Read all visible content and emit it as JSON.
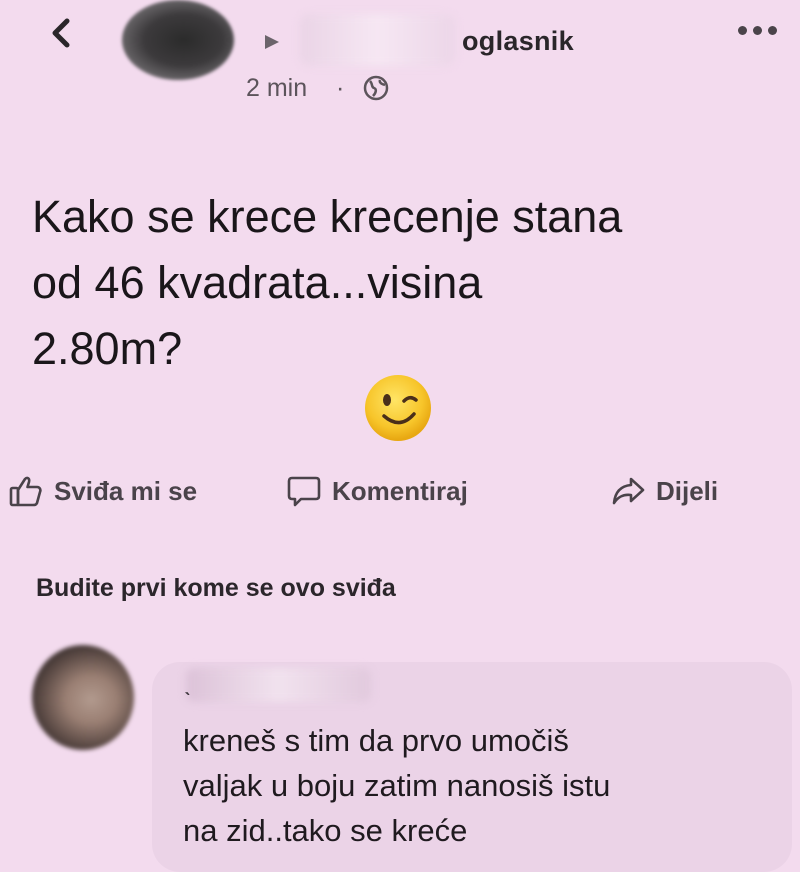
{
  "header": {
    "back_icon": "chevron-left-icon",
    "group_name": "oglasnik",
    "time": "2 min",
    "separator": "·",
    "audience_icon": "globe-icon",
    "more_icon": "ellipsis-icon"
  },
  "post": {
    "text": "Kako se krece krecenje stana\nod 46 kvadrata...visina\n2.80m?",
    "emoji": "winking-face-icon"
  },
  "actions": {
    "like": "Sviđa mi se",
    "comment": "Komentiraj",
    "share": "Dijeli"
  },
  "likes_line": "Budite prvi kome se ovo sviđa",
  "comment": {
    "text": "kreneš s tim da prvo umočiš\nvaljak u boju zatim nanosiš istu\nna zid..tako se kreće"
  },
  "colors": {
    "background": "#f3dbee",
    "bubble": "#ebd3e7",
    "action_text": "#4a434a"
  }
}
